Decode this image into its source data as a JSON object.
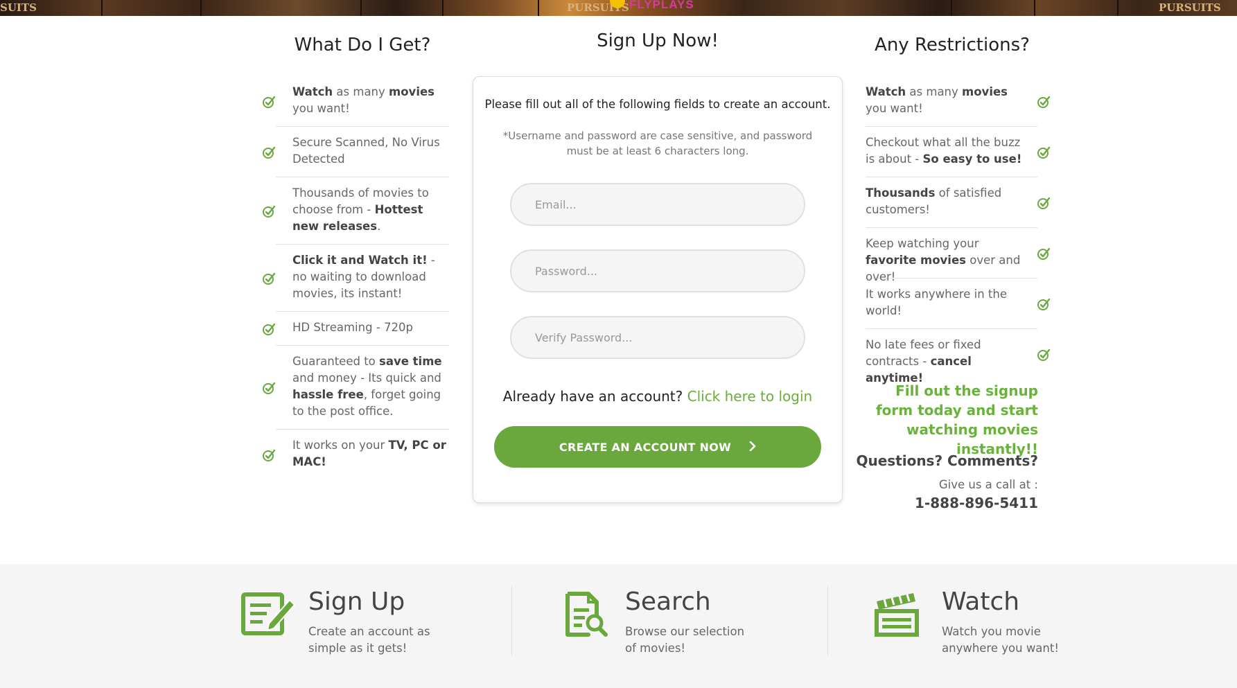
{
  "banner": {
    "left_text": "SUITS",
    "mid_text": "PURSUITS",
    "right_text": "PURSUITS",
    "brand": "FLYPLAYS"
  },
  "left_column": {
    "title": "What Do I Get?",
    "items": [
      {
        "parts": [
          {
            "t": "Watch",
            "b": true
          },
          {
            "t": " as many ",
            "b": false
          },
          {
            "t": "movies",
            "b": true
          },
          {
            "t": " you want!",
            "b": false
          }
        ]
      },
      {
        "parts": [
          {
            "t": "Secure Scanned, No Virus Detected",
            "b": false
          }
        ]
      },
      {
        "parts": [
          {
            "t": "Thousands of movies to choose from - ",
            "b": false
          },
          {
            "t": "Hottest new releases",
            "b": true
          },
          {
            "t": ".",
            "b": false
          }
        ]
      },
      {
        "parts": [
          {
            "t": "Click it and Watch it!",
            "b": true
          },
          {
            "t": " - no waiting to download movies, its instant!",
            "b": false
          }
        ]
      },
      {
        "parts": [
          {
            "t": "HD Streaming - 720p",
            "b": false
          }
        ]
      },
      {
        "parts": [
          {
            "t": "Guaranteed to ",
            "b": false
          },
          {
            "t": "save time",
            "b": true
          },
          {
            "t": " and money - Its quick and ",
            "b": false
          },
          {
            "t": "hassle free",
            "b": true
          },
          {
            "t": ", forget going to the post office.",
            "b": false
          }
        ]
      },
      {
        "parts": [
          {
            "t": "It works on your ",
            "b": false
          },
          {
            "t": "TV, PC or MAC!",
            "b": true
          }
        ]
      }
    ]
  },
  "signup": {
    "title": "Sign Up Now!",
    "intro": "Please fill out all of the following fields to create an account.",
    "note": "*Username and password are case sensitive, and password must be at least 6 characters long.",
    "email_placeholder": "Email...",
    "password_placeholder": "Password...",
    "verify_placeholder": "Verify Password...",
    "login_prompt": "Already have an account?",
    "login_link": "Click here to login",
    "cta_label": "CREATE AN ACCOUNT NOW",
    "cta_arrow": "›"
  },
  "right_column": {
    "title": "Any Restrictions?",
    "items": [
      {
        "parts": [
          {
            "t": "Watch",
            "b": true
          },
          {
            "t": " as many ",
            "b": false
          },
          {
            "t": "movies",
            "b": true
          },
          {
            "t": " you want!",
            "b": false
          }
        ]
      },
      {
        "parts": [
          {
            "t": "Checkout what all the buzz is about - ",
            "b": false
          },
          {
            "t": "So easy to use!",
            "b": true
          }
        ]
      },
      {
        "parts": [
          {
            "t": "Thousands",
            "b": true
          },
          {
            "t": " of satisfied customers!",
            "b": false
          }
        ]
      },
      {
        "parts": [
          {
            "t": "Keep watching your ",
            "b": false
          },
          {
            "t": "favorite movies",
            "b": true
          },
          {
            "t": " over and over!",
            "b": false
          }
        ]
      },
      {
        "parts": [
          {
            "t": "It works anywhere in the world!",
            "b": false
          }
        ]
      },
      {
        "parts": [
          {
            "t": "No late fees or fixed contracts - ",
            "b": false
          },
          {
            "t": "cancel anytime!",
            "b": true
          }
        ]
      }
    ],
    "promo": "Fill out the signup form today and start watching movies instantly!!",
    "questions": "Questions? Comments?",
    "call_label": "Give us a call at :",
    "phone": "1-888-896-5411"
  },
  "steps": [
    {
      "title": "Sign Up",
      "desc": "Create an account as simple as it gets!",
      "icon": "signup-form-icon"
    },
    {
      "title": "Search",
      "desc": "Browse our selection of movies!",
      "icon": "search-document-icon"
    },
    {
      "title": "Watch",
      "desc": "Watch you movie anywhere you want!",
      "icon": "clapperboard-icon"
    }
  ],
  "colors": {
    "accent_green": "#6aa83d",
    "link_green": "#6aad3d",
    "brand_pink": "#d63aa0"
  }
}
